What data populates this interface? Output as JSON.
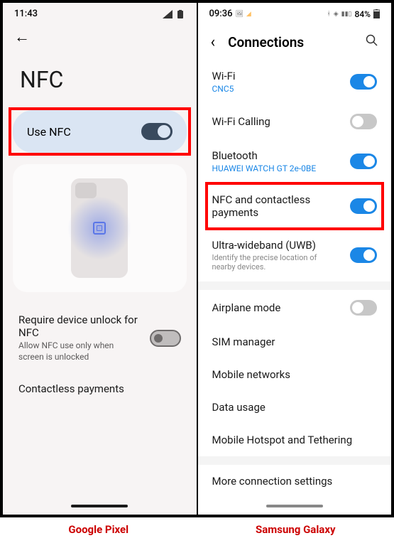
{
  "pixel": {
    "time": "11:43",
    "title": "NFC",
    "use_nfc": "Use NFC",
    "require_title": "Require device unlock for NFC",
    "require_sub": "Allow NFC use only when screen is unlocked",
    "contactless": "Contactless payments"
  },
  "samsung": {
    "time": "09:36",
    "battery": "84%",
    "header": "Connections",
    "items": [
      {
        "label": "Wi-Fi",
        "sub": "CNC5",
        "toggle": "on",
        "subColor": "blue"
      },
      {
        "label": "Wi-Fi Calling",
        "toggle": "off"
      },
      {
        "label": "Bluetooth",
        "sub": "HUAWEI WATCH GT 2e-0BE",
        "toggle": "on",
        "subColor": "blue"
      },
      {
        "label": "NFC and contactless payments",
        "toggle": "on",
        "highlight": true
      },
      {
        "label": "Ultra-wideband (UWB)",
        "sub": "Identify the precise location of nearby devices.",
        "toggle": "on",
        "subColor": "gray"
      }
    ],
    "group2": [
      {
        "label": "Airplane mode",
        "toggle": "off"
      },
      {
        "label": "SIM manager"
      },
      {
        "label": "Mobile networks"
      },
      {
        "label": "Data usage"
      },
      {
        "label": "Mobile Hotspot and Tethering"
      }
    ],
    "more": "More connection settings"
  },
  "labels": {
    "pixel": "Google Pixel",
    "samsung": "Samsung Galaxy"
  }
}
